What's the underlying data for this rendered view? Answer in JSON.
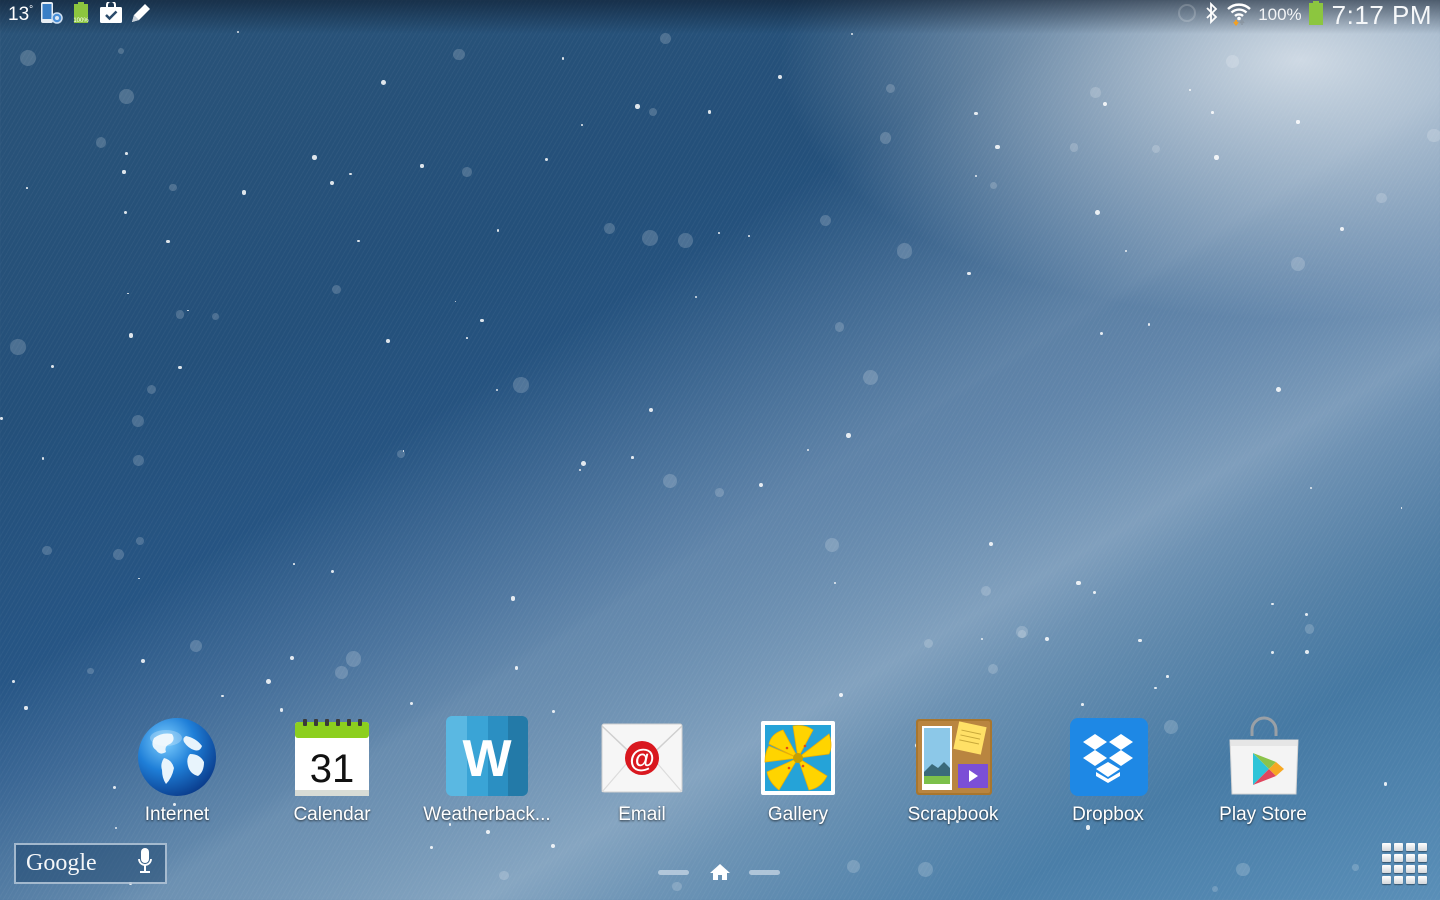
{
  "status_bar": {
    "left": {
      "temperature": "13",
      "temperature_unit": "°",
      "icons": [
        "device-settings-icon",
        "battery-full-icon",
        "task-check-icon",
        "pen-icon"
      ],
      "battery_small_label": "100%"
    },
    "right": {
      "icons": [
        "sync-icon",
        "bluetooth-icon",
        "wifi-icon",
        "battery-icon"
      ],
      "battery_percent": "100%",
      "time": "7:17 PM"
    }
  },
  "dock": {
    "apps": [
      {
        "label": "Internet",
        "icon": "globe-icon"
      },
      {
        "label": "Calendar",
        "icon": "calendar-icon",
        "icon_text": "31"
      },
      {
        "label": "Weatherback...",
        "icon": "weatherback-icon",
        "icon_text": "W"
      },
      {
        "label": "Email",
        "icon": "email-icon",
        "icon_text": "@"
      },
      {
        "label": "Gallery",
        "icon": "gallery-icon"
      },
      {
        "label": "Scrapbook",
        "icon": "scrapbook-icon"
      },
      {
        "label": "Dropbox",
        "icon": "dropbox-icon"
      },
      {
        "label": "Play Store",
        "icon": "play-store-icon"
      }
    ]
  },
  "search_widget": {
    "logo_text": "Google",
    "mic_icon": "microphone-icon"
  },
  "navigation": {
    "home_icon": "home-icon",
    "pages": 3,
    "current_page": 2,
    "apps_button": "apps-grid-icon"
  },
  "colors": {
    "battery_green": "#8cc63f",
    "wallpaper_blue": "#24507a",
    "dropbox_blue": "#1e88e5",
    "email_red": "#d9181f",
    "calendar_green": "#8ccf1e"
  }
}
